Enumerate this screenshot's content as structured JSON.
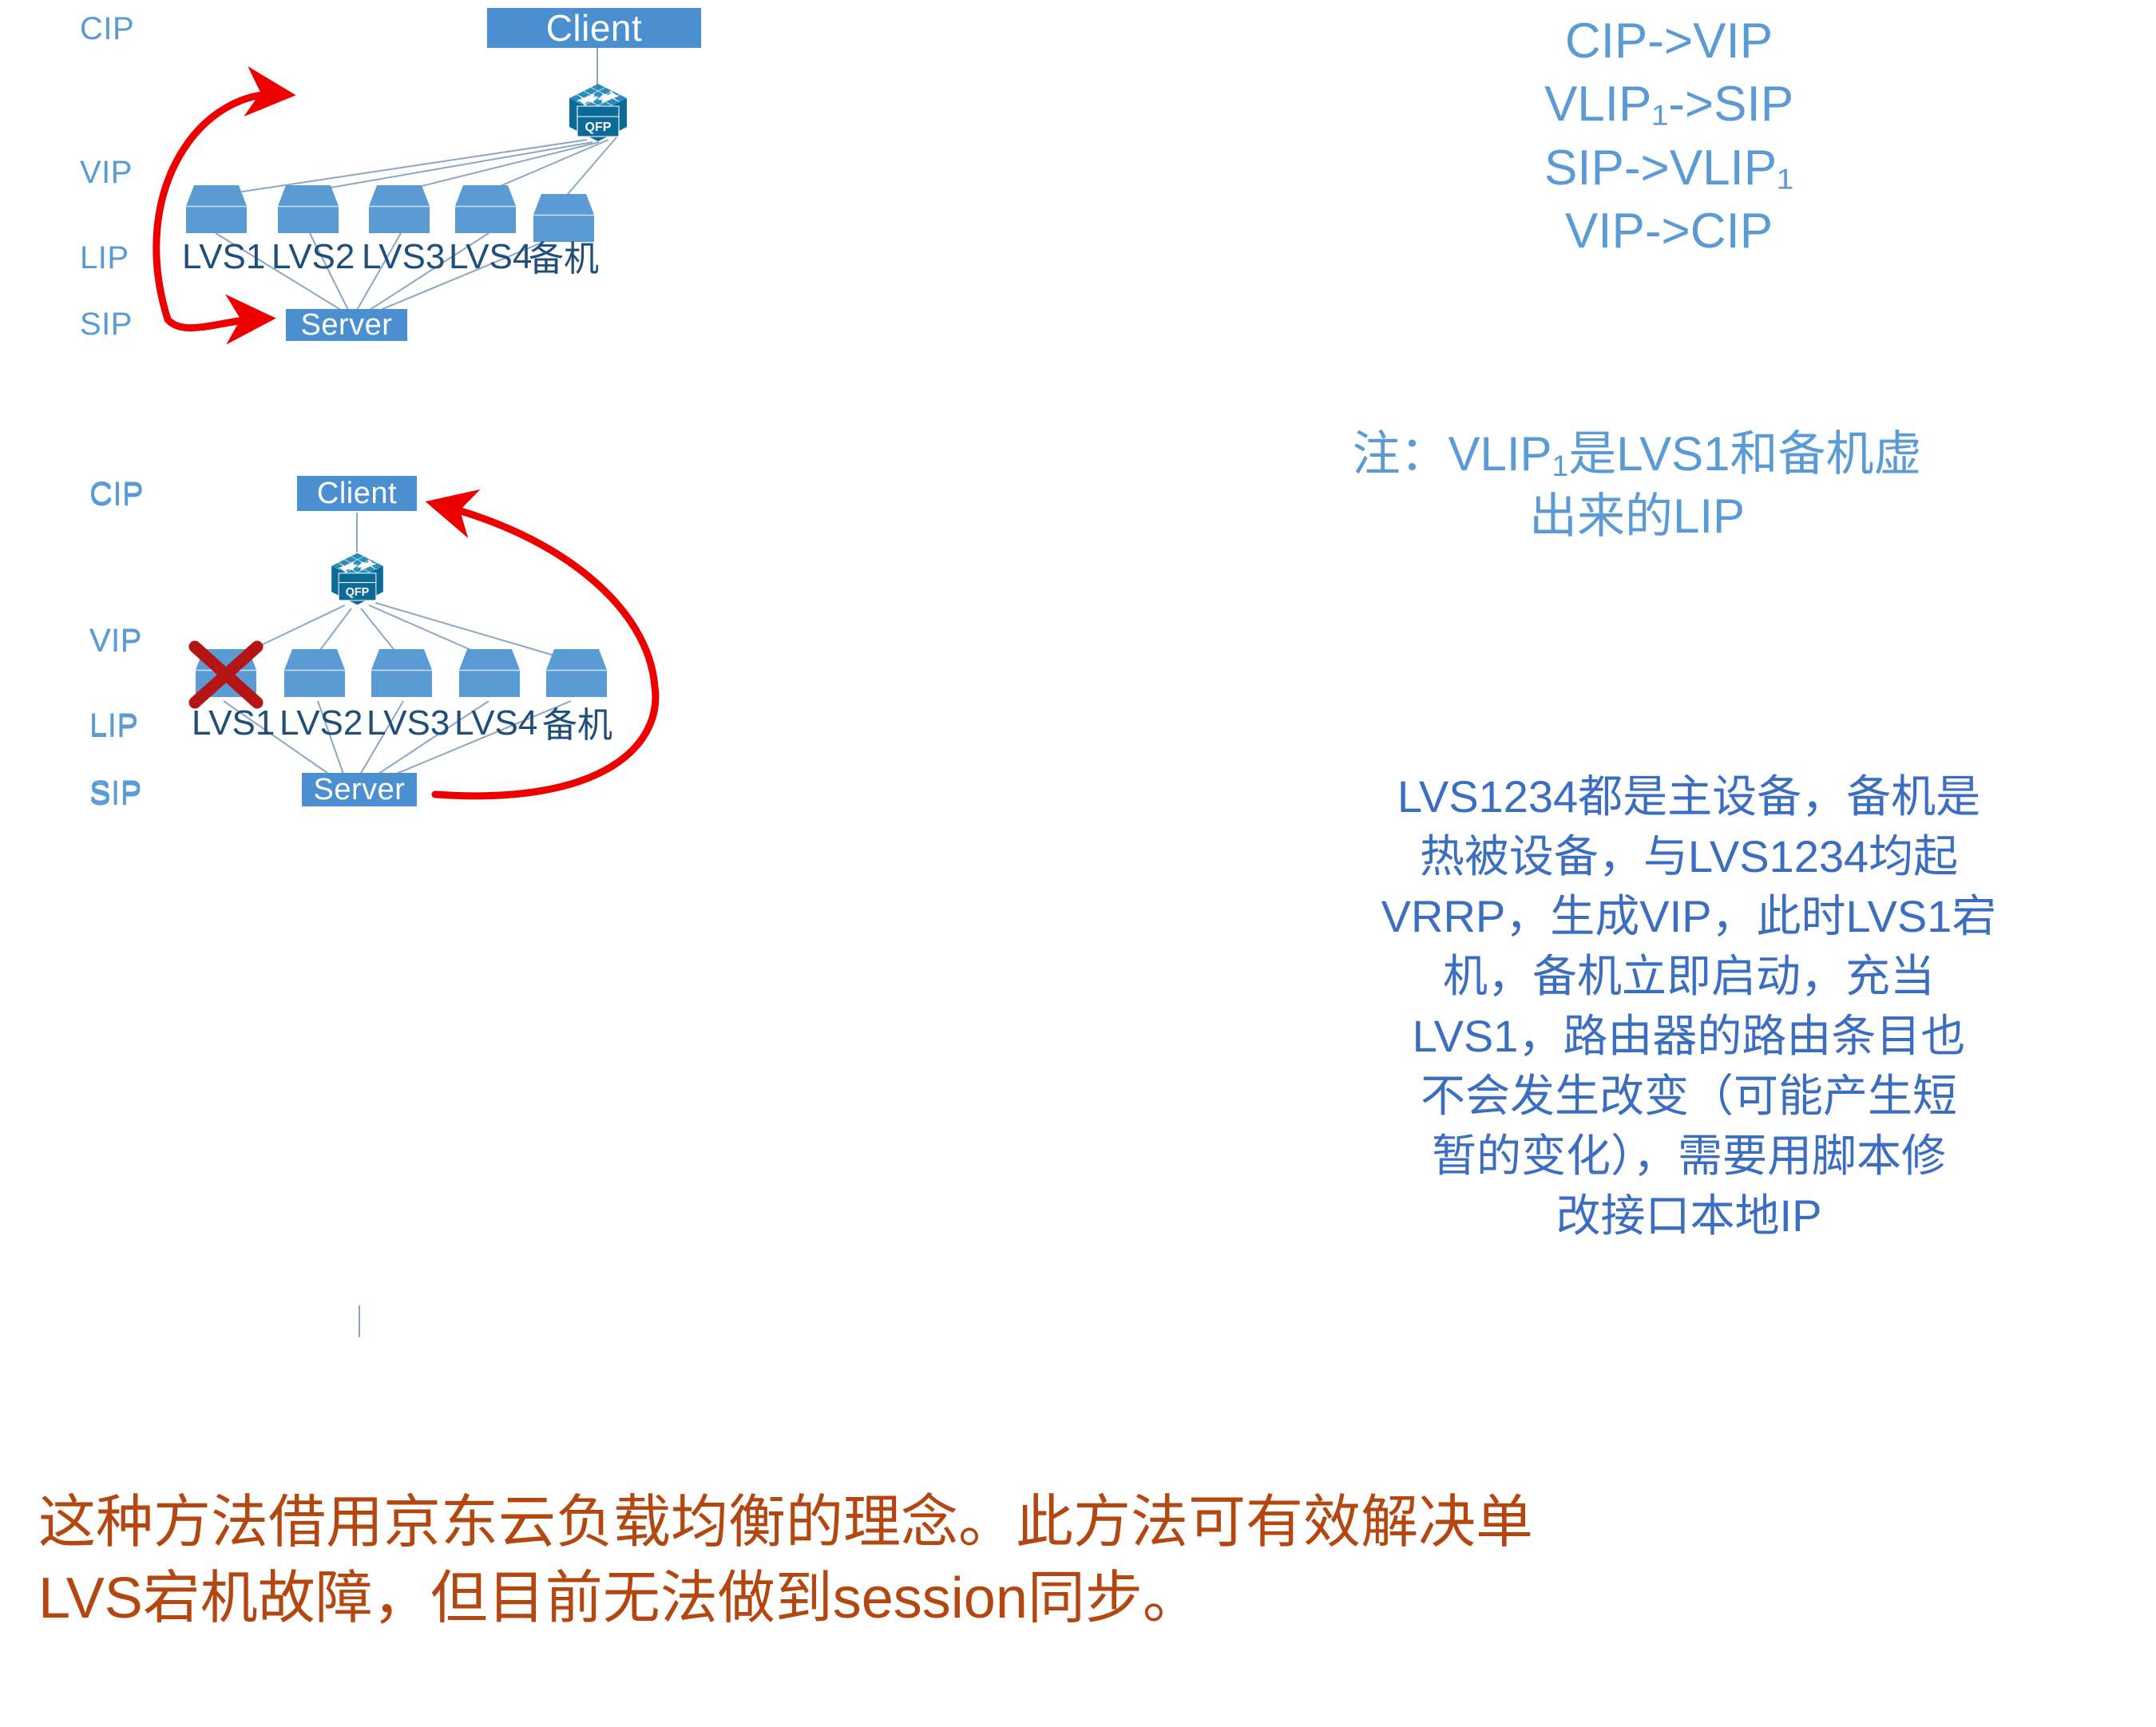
{
  "diagram1": {
    "axis_labels": [
      "CIP",
      "VIP",
      "LIP",
      "SIP"
    ],
    "client_label": "Client",
    "server_label": "Server",
    "router_label": "QFP",
    "lvs_nodes": [
      "LVS1",
      "LVS2",
      "LVS3",
      "LVS4",
      "备机"
    ]
  },
  "diagram2": {
    "axis_labels": [
      "CIP",
      "VIP",
      "LIP",
      "SIP"
    ],
    "client_label": "Client",
    "server_label": "Server",
    "router_label": "QFP",
    "lvs_nodes": [
      "LVS1",
      "LVS2",
      "LVS3",
      "LVS4",
      "备机"
    ],
    "failed_node": "LVS1"
  },
  "ip_flows": [
    "CIP->VIP",
    "VLIP₁->SIP",
    "SIP->VLIP₁",
    "VIP->CIP"
  ],
  "ip_flow_rows": [
    {
      "pre": "CIP->VIP",
      "sub": "",
      "post": ""
    },
    {
      "pre": "VLIP",
      "sub": "1",
      "post": "->SIP"
    },
    {
      "pre": "SIP->VLIP",
      "sub": "1",
      "post": ""
    },
    {
      "pre": "VIP->CIP",
      "sub": "",
      "post": ""
    }
  ],
  "note": {
    "line1_pre": "注：VLIP",
    "line1_sub": "1",
    "line1_post": "是LVS1和备机虚",
    "line2": "出来的LIP"
  },
  "description": {
    "lines": [
      "LVS1234都是主设备，备机是",
      "热被设备，与LVS1234均起",
      "VRRP，生成VIP，此时LVS1宕",
      "机，备机立即启动，充当",
      "LVS1，路由器的路由条目也",
      "不会发生改变（可能产生短",
      "暂的变化），需要用脚本修",
      "改接口本地IP"
    ]
  },
  "bottom_note": {
    "line1": "这种方法借用京东云负载均衡的理念。此方法可有效解决单",
    "line2": "LVS宕机故障，但目前无法做到session同步。"
  },
  "colors": {
    "node_blue": "#4a8fd0",
    "axis_blue": "#5b9bd5",
    "caption_navy": "#1f4e79",
    "router_teal": "#0c6a96",
    "arrow_red": "#ee0000",
    "x_red": "#b51414",
    "desc_blue": "#3b6ec0",
    "bottom_orange": "#b4460f",
    "link_gray": "#8ca7c4"
  }
}
